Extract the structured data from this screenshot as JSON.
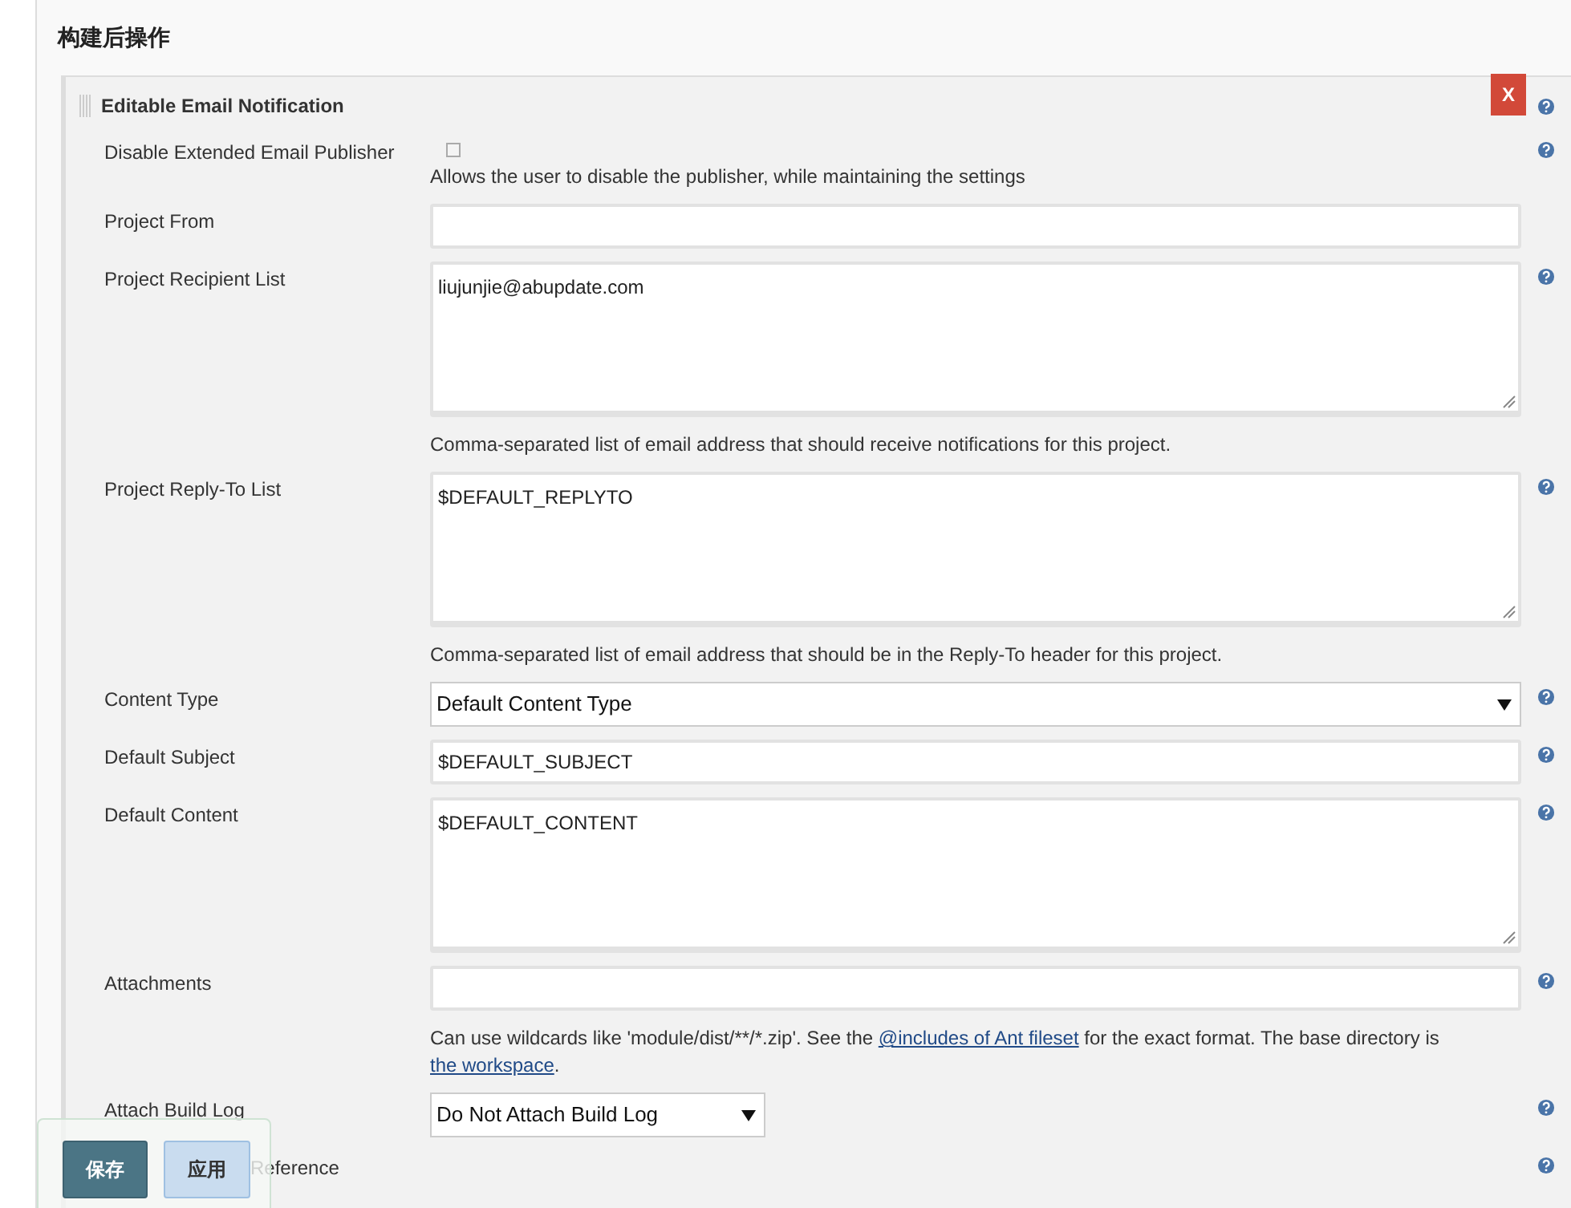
{
  "section_title": "构建后操作",
  "publisher": {
    "title": "Editable Email Notification",
    "delete_label": "X",
    "fields": [
      {
        "kind": "checkbox",
        "label": "Disable Extended Email Publisher",
        "checked": false,
        "help": true,
        "description": [
          {
            "kind": "text",
            "text": "Allows the user to disable the publisher, while maintaining the settings"
          }
        ]
      },
      {
        "kind": "text",
        "label": "Project From",
        "help": false
      },
      {
        "kind": "textarea",
        "label": "Project Recipient List",
        "value": "liujunjie@abupdate.com",
        "help": true,
        "description": [
          {
            "kind": "text",
            "text": "Comma-separated list of email address that should receive notifications for this project."
          }
        ]
      },
      {
        "kind": "textarea",
        "label": "Project Reply-To List",
        "value": "$DEFAULT_REPLYTO",
        "help": true,
        "description": [
          {
            "kind": "text",
            "text": "Comma-separated list of email address that should be in the Reply-To header for this project."
          }
        ]
      },
      {
        "kind": "select",
        "label": "Content Type",
        "value": "Default Content Type",
        "help": true,
        "wide": true
      },
      {
        "kind": "text",
        "label": "Default Subject",
        "value": "$DEFAULT_SUBJECT",
        "help": true
      },
      {
        "kind": "textarea",
        "label": "Default Content",
        "value": "$DEFAULT_CONTENT",
        "help": true
      },
      {
        "kind": "text",
        "label": "Attachments",
        "help": true,
        "description": [
          {
            "kind": "text",
            "text": "Can use wildcards like 'module/dist/**/*.zip'. See the "
          },
          {
            "kind": "link",
            "text": "@includes of Ant fileset"
          },
          {
            "kind": "text",
            "text": " for the exact format. The base directory is "
          },
          {
            "kind": "link",
            "text": "the workspace"
          },
          {
            "kind": "text",
            "text": "."
          }
        ]
      },
      {
        "kind": "select",
        "label": "Attach Build Log",
        "value": "Do Not Attach Build Log",
        "help": true,
        "wide": false
      },
      {
        "kind": "label",
        "label": "Reference",
        "help": true
      }
    ]
  },
  "buttons": [
    {
      "label": "保存",
      "kind": "primary"
    },
    {
      "label": "应用",
      "kind": "secondary"
    }
  ]
}
